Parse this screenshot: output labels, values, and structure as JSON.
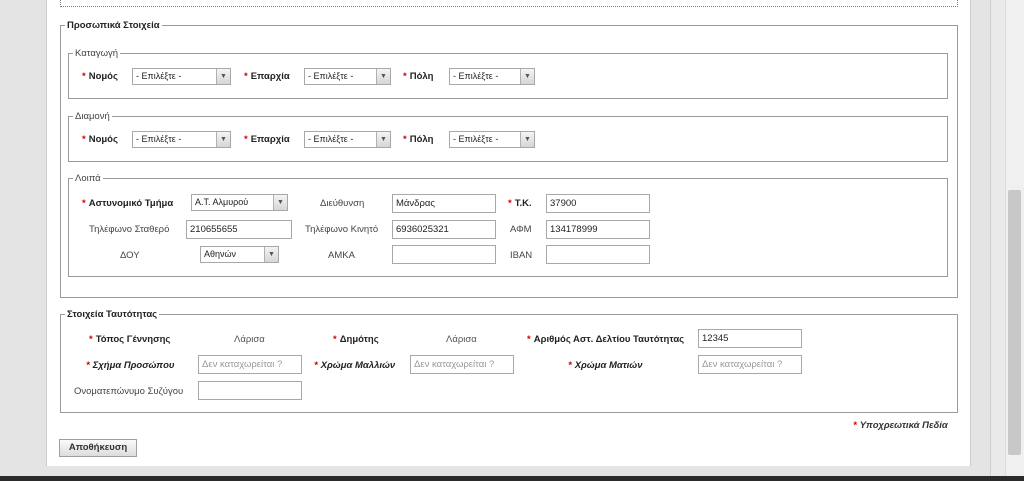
{
  "personal": {
    "legend": "Προσωπικά Στοιχεία",
    "origin": {
      "legend": "Καταγωγή",
      "nomos_label": "Νομός",
      "nomos_value": "- Επιλέξτε -",
      "eparxia_label": "Επαρχία",
      "eparxia_value": "- Επιλέξτε -",
      "poli_label": "Πόλη",
      "poli_value": "- Επιλέξτε -"
    },
    "residence": {
      "legend": "Διαμονή",
      "nomos_label": "Νομός",
      "nomos_value": "- Επιλέξτε -",
      "eparxia_label": "Επαρχία",
      "eparxia_value": "- Επιλέξτε -",
      "poli_label": "Πόλη",
      "poli_value": "- Επιλέξτε -"
    },
    "other": {
      "legend": "Λοιπά",
      "police_label": "Αστυνομικό Τμήμα",
      "police_value": "Α.Τ. Αλμυρού",
      "address_label": "Διεύθυνση",
      "address_value": "Μάνδρας",
      "tk_label": "Τ.Κ.",
      "tk_value": "37900",
      "landline_label": "Τηλέφωνο Σταθερό",
      "landline_value": "210655655",
      "mobile_label": "Τηλέφωνο Κινητό",
      "mobile_value": "6936025321",
      "afm_label": "ΑΦΜ",
      "afm_value": "134178999",
      "doy_label": "ΔΟΥ",
      "doy_value": "Αθηνών",
      "amka_label": "ΑΜΚΑ",
      "amka_value": "",
      "iban_label": "IBAN",
      "iban_value": ""
    }
  },
  "identity": {
    "legend": "Στοιχεία Ταυτότητας",
    "birthplace_label": "Τόπος Γέννησης",
    "birthplace_value": "Λάρισα",
    "dimotis_label": "Δημότης",
    "dimotis_value": "Λάρισα",
    "id_number_label": "Αριθμός Αστ. Δελτίου Ταυτότητας",
    "id_number_value": "12345",
    "face_shape_label": "Σχήμα Προσώπου",
    "face_shape_placeholder": "Δεν καταχωρείται ?",
    "hair_color_label": "Χρώμα Μαλλιών",
    "hair_color_placeholder": "Δεν καταχωρείται ?",
    "eye_color_label": "Χρώμα Ματιών",
    "eye_color_placeholder": "Δεν καταχωρείται ?",
    "spouse_label": "Ονοματεπώνυμο Συζύγου",
    "spouse_value": ""
  },
  "footer": {
    "required_note": "Υποχρεωτικά Πεδία",
    "save_label": "Αποθήκευση"
  },
  "icons": {
    "select_arrow": "chevron-down-icon"
  }
}
